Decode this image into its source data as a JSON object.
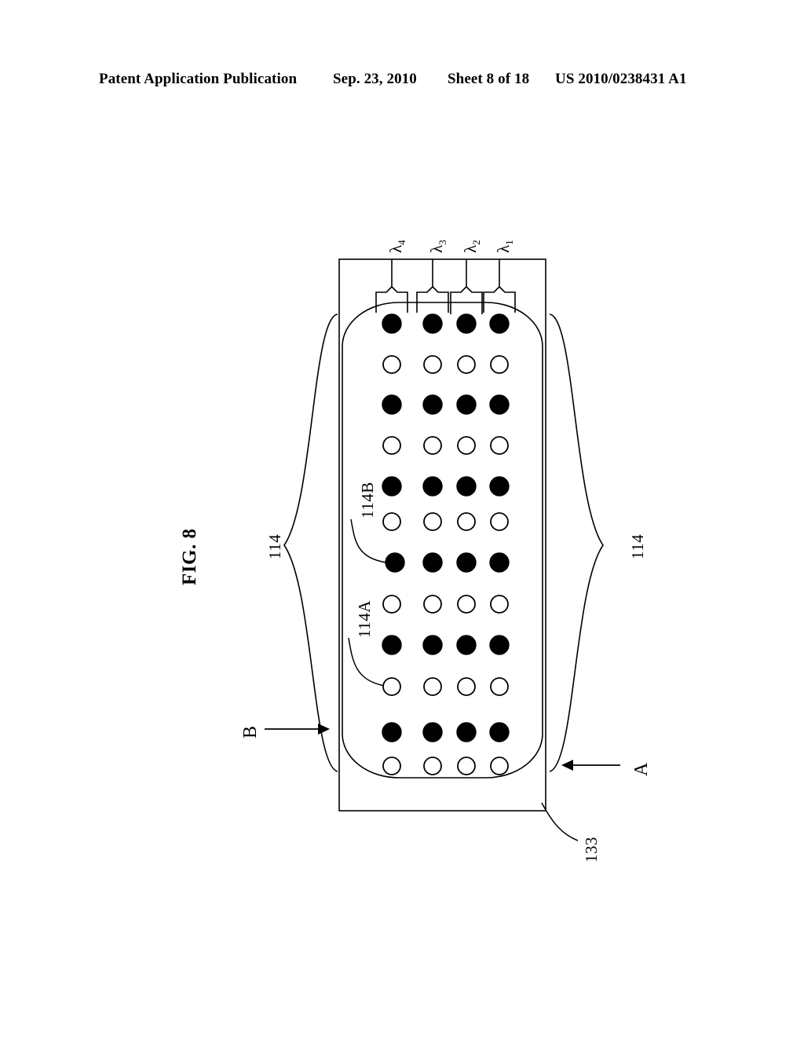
{
  "header": {
    "publication": "Patent Application Publication",
    "date": "Sep. 23, 2010",
    "sheet": "Sheet 8 of 18",
    "patent_number": "US 2010/0238431 A1"
  },
  "figure": {
    "label": "FIG. 8",
    "wavelength_ports": [
      {
        "id": "lambda4",
        "symbol": "λ",
        "subscript": "4"
      },
      {
        "id": "lambda3",
        "symbol": "λ",
        "subscript": "3"
      },
      {
        "id": "lambda2",
        "symbol": "λ",
        "subscript": "2"
      },
      {
        "id": "lambda1",
        "symbol": "λ",
        "subscript": "1"
      }
    ],
    "reference_numerals": {
      "brace_left": "114",
      "brace_right": "114",
      "hollow_dot": "114A",
      "filled_dot": "114B",
      "substrate": "133"
    },
    "section_markers": {
      "b": "B",
      "a": "A"
    },
    "dot_grid": {
      "columns": 4,
      "rows": 12,
      "row_fill": [
        "filled",
        "hollow",
        "filled",
        "hollow",
        "filled",
        "hollow",
        "filled",
        "hollow",
        "filled",
        "hollow",
        "filled",
        "hollow"
      ]
    },
    "colors": {
      "ink": "#000000",
      "paper": "#ffffff"
    }
  }
}
